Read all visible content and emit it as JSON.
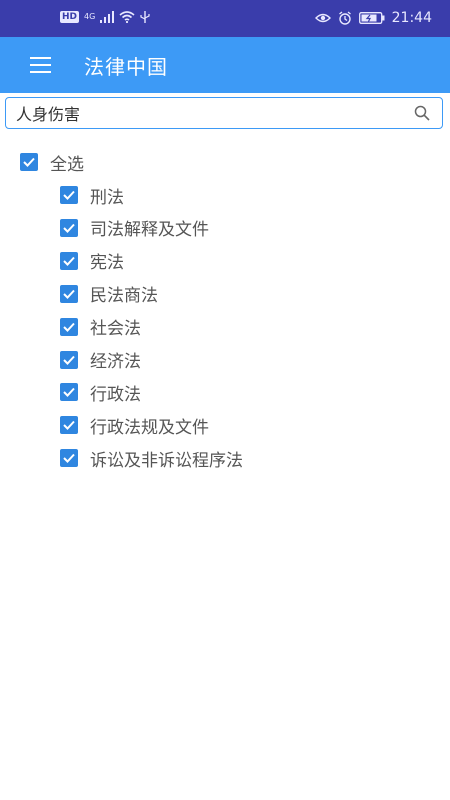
{
  "status_bar": {
    "hd_badge": "HD",
    "network": "4G",
    "time": "21:44"
  },
  "app_bar": {
    "title": "法律中国"
  },
  "search": {
    "value": "人身伤害"
  },
  "select_all": {
    "label": "全选",
    "checked": true
  },
  "categories": [
    {
      "label": "刑法",
      "checked": true
    },
    {
      "label": "司法解释及文件",
      "checked": true
    },
    {
      "label": "宪法",
      "checked": true
    },
    {
      "label": "民法商法",
      "checked": true
    },
    {
      "label": "社会法",
      "checked": true
    },
    {
      "label": "经济法",
      "checked": true
    },
    {
      "label": "行政法",
      "checked": true
    },
    {
      "label": "行政法规及文件",
      "checked": true
    },
    {
      "label": "诉讼及非诉讼程序法",
      "checked": true
    }
  ],
  "colors": {
    "status_bar": "#3a3dab",
    "app_bar": "#3d9af6",
    "checkbox": "#2f86e0"
  }
}
